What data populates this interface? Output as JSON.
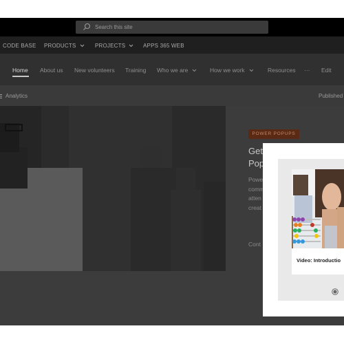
{
  "suitebar": {
    "search_placeholder": "Search this site"
  },
  "hub_nav": {
    "items": [
      {
        "label": "CODE BASE"
      },
      {
        "label": "PRODUCTS"
      },
      {
        "label": "PROJECTS"
      },
      {
        "label": "APPS 365 WEB"
      }
    ]
  },
  "site_nav": {
    "items": [
      {
        "label": "Home"
      },
      {
        "label": "About us"
      },
      {
        "label": "New volunteers"
      },
      {
        "label": "Training"
      },
      {
        "label": "Who we are"
      },
      {
        "label": "How we work"
      },
      {
        "label": "Resources"
      },
      {
        "label": "···"
      },
      {
        "label": "Edit"
      }
    ]
  },
  "command_bar": {
    "analytics": "Analytics",
    "published": "Published"
  },
  "article": {
    "topic": "POWER POPUPS",
    "title": "Get\nPop",
    "description": "Powe\ncomm\natten\ncreat",
    "continue": "Cont"
  },
  "popup": {
    "video_title": "Video: Introductio"
  },
  "colors": {
    "suitebar_bg": "#000000",
    "overlay_dim": "#3a3a3a",
    "topic_badge": "#5a2a14",
    "popup_bg": "#ffffff"
  }
}
